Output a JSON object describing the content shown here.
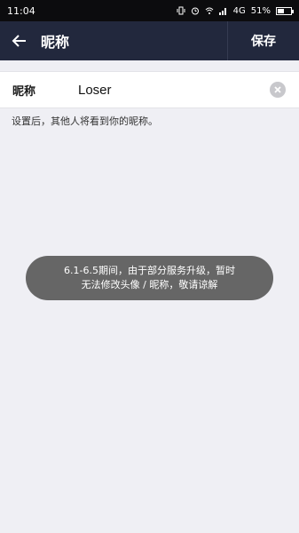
{
  "status_bar": {
    "time": "11:04",
    "network": "4G",
    "battery": "51%",
    "battery_level": 0.51,
    "icons": [
      "vibrate-icon",
      "alarm-icon",
      "wifi-icon",
      "signal-icon",
      "battery-icon"
    ]
  },
  "header": {
    "back_icon": "arrow-left-icon",
    "title": "昵称",
    "save_label": "保存"
  },
  "form": {
    "label": "昵称",
    "value": "Loser",
    "clear_icon": "clear-icon"
  },
  "hint": "设置后，其他人将看到你的昵称。",
  "toast": {
    "line1": "6.1-6.5期间，由于部分服务升级，暂时",
    "line2": "无法修改头像 / 昵称，敬请谅解"
  },
  "colors": {
    "app_bar": "#22283d",
    "status_bar": "#0c0c0e",
    "background": "#efeff4",
    "toast": "#666666"
  }
}
